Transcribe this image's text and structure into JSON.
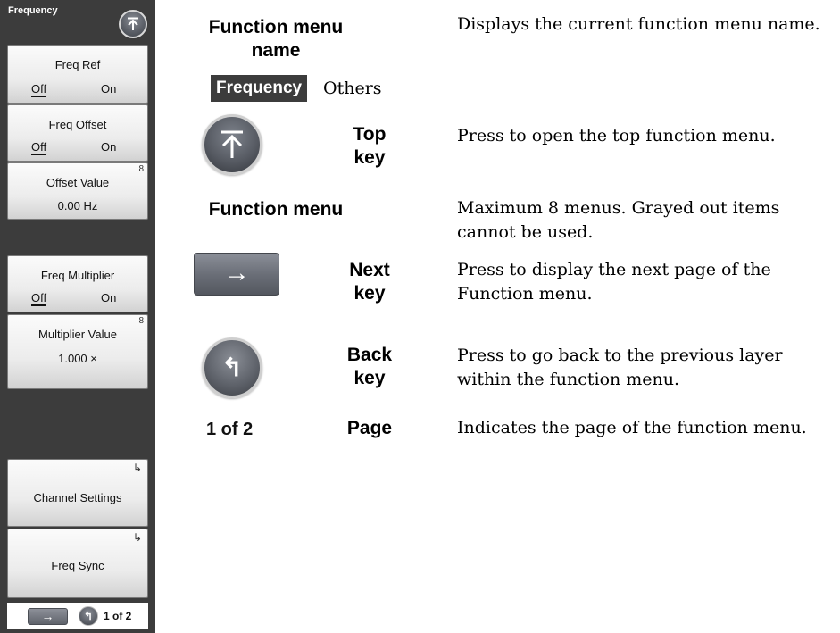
{
  "panel": {
    "menu_name": "Frequency",
    "buttons": [
      {
        "label": "Freq Ref",
        "off": "Off",
        "on": "On"
      },
      {
        "label": "Freq Offset",
        "off": "Off",
        "on": "On"
      },
      {
        "label": "Offset Value",
        "value": "0.00 Hz",
        "corner_mark": "8"
      },
      {
        "label": "Freq Multiplier",
        "off": "Off",
        "on": "On"
      },
      {
        "label": "Multiplier Value",
        "value": "1.000 ×",
        "corner_mark": "8"
      },
      {
        "label": "Channel Settings",
        "submenu_mark": "↳"
      },
      {
        "label": "Freq Sync",
        "submenu_mark": "↳"
      }
    ],
    "bottom": {
      "next_symbol": "→",
      "back_symbol": "↰",
      "page": "1 of 2"
    }
  },
  "legend": {
    "function_menu_name": {
      "label": "Function menu name",
      "desc": "Displays the current function menu name.",
      "tag_text": "Frequency",
      "others_text": "Others"
    },
    "top_key": {
      "label_line1": "Top",
      "label_line2": "key",
      "desc": "Press to open the top function menu."
    },
    "function_menu": {
      "label": "Function menu",
      "desc": "Maximum 8 menus. Grayed out items cannot be used."
    },
    "next_key": {
      "label_line1": "Next",
      "label_line2": "key",
      "desc": "Press to display the next page of the Function menu.",
      "symbol": "→"
    },
    "back_key": {
      "label_line1": "Back",
      "label_line2": "key",
      "desc": "Press to go back to the previous layer within the function menu.",
      "symbol": "↰"
    },
    "page": {
      "label": "Page",
      "desc": "Indicates the page of the function menu.",
      "indicator": "1 of 2"
    }
  },
  "icons": {
    "top_key_icon": "arrow-up-to-bar-icon",
    "next_key_icon": "arrow-right-icon",
    "back_key_icon": "return-arrow-icon"
  },
  "colors": {
    "panel_background": "#3c3c3c",
    "button_face": "#ececec",
    "key_gray": "#5c6068"
  }
}
